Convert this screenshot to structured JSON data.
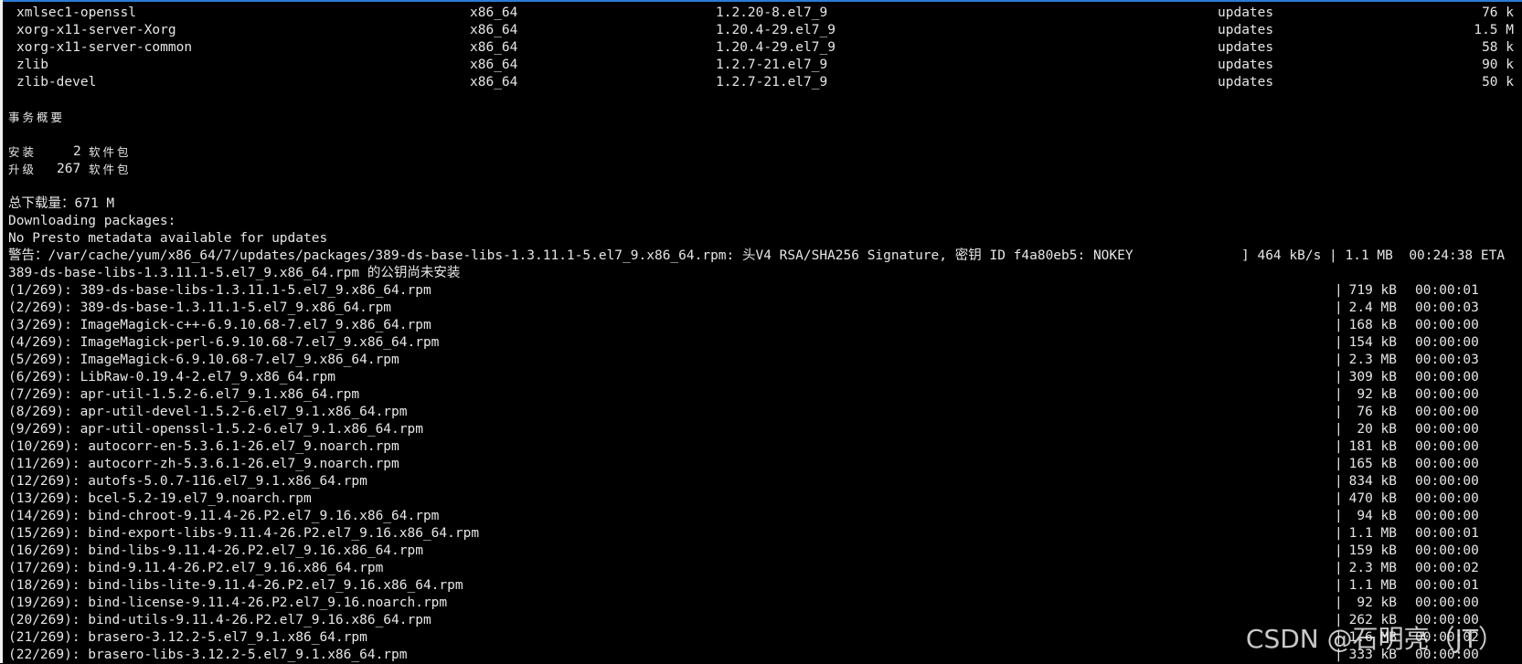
{
  "packages": [
    {
      "name": "xmlsec1-openssl",
      "arch": "x86_64",
      "version": "1.2.20-8.el7_9",
      "repo": "updates",
      "size": "76 k"
    },
    {
      "name": "xorg-x11-server-Xorg",
      "arch": "x86_64",
      "version": "1.20.4-29.el7_9",
      "repo": "updates",
      "size": "1.5 M"
    },
    {
      "name": "xorg-x11-server-common",
      "arch": "x86_64",
      "version": "1.20.4-29.el7_9",
      "repo": "updates",
      "size": "58 k"
    },
    {
      "name": "zlib",
      "arch": "x86_64",
      "version": "1.2.7-21.el7_9",
      "repo": "updates",
      "size": "90 k"
    },
    {
      "name": "zlib-devel",
      "arch": "x86_64",
      "version": "1.2.7-21.el7_9",
      "repo": "updates",
      "size": "50 k"
    }
  ],
  "summary": {
    "title": "事务概要",
    "install_label": "安装",
    "install_count": "2",
    "install_unit": "软件包",
    "upgrade_label": "升级",
    "upgrade_count": "267",
    "upgrade_unit": "软件包",
    "total_download": "总下载量：671 M"
  },
  "messages": {
    "downloading": "Downloading packages:",
    "no_presto": "No Presto metadata available for updates",
    "warning": "警告：/var/cache/yum/x86_64/7/updates/packages/389-ds-base-libs-1.3.11.1-5.el7_9.x86_64.rpm: 头V4 RSA/SHA256 Signature, 密钥 ID f4a80eb5: NOKEY",
    "warning_stats": "] 464 kB/s | 1.1 MB  00:24:38 ETA",
    "pubkey": "389-ds-base-libs-1.3.11.1-5.el7_9.x86_64.rpm 的公钥尚未安装"
  },
  "downloads": [
    {
      "file": "(1/269): 389-ds-base-libs-1.3.11.1-5.el7_9.x86_64.rpm",
      "size": "719 kB",
      "time": "00:00:01"
    },
    {
      "file": "(2/269): 389-ds-base-1.3.11.1-5.el7_9.x86_64.rpm",
      "size": "2.4 MB",
      "time": "00:00:03"
    },
    {
      "file": "(3/269): ImageMagick-c++-6.9.10.68-7.el7_9.x86_64.rpm",
      "size": "168 kB",
      "time": "00:00:00"
    },
    {
      "file": "(4/269): ImageMagick-perl-6.9.10.68-7.el7_9.x86_64.rpm",
      "size": "154 kB",
      "time": "00:00:00"
    },
    {
      "file": "(5/269): ImageMagick-6.9.10.68-7.el7_9.x86_64.rpm",
      "size": "2.3 MB",
      "time": "00:00:03"
    },
    {
      "file": "(6/269): LibRaw-0.19.4-2.el7_9.x86_64.rpm",
      "size": "309 kB",
      "time": "00:00:00"
    },
    {
      "file": "(7/269): apr-util-1.5.2-6.el7_9.1.x86_64.rpm",
      "size": "92 kB",
      "time": "00:00:00"
    },
    {
      "file": "(8/269): apr-util-devel-1.5.2-6.el7_9.1.x86_64.rpm",
      "size": "76 kB",
      "time": "00:00:00"
    },
    {
      "file": "(9/269): apr-util-openssl-1.5.2-6.el7_9.1.x86_64.rpm",
      "size": "20 kB",
      "time": "00:00:00"
    },
    {
      "file": "(10/269): autocorr-en-5.3.6.1-26.el7_9.noarch.rpm",
      "size": "181 kB",
      "time": "00:00:00"
    },
    {
      "file": "(11/269): autocorr-zh-5.3.6.1-26.el7_9.noarch.rpm",
      "size": "165 kB",
      "time": "00:00:00"
    },
    {
      "file": "(12/269): autofs-5.0.7-116.el7_9.1.x86_64.rpm",
      "size": "834 kB",
      "time": "00:00:00"
    },
    {
      "file": "(13/269): bcel-5.2-19.el7_9.noarch.rpm",
      "size": "470 kB",
      "time": "00:00:00"
    },
    {
      "file": "(14/269): bind-chroot-9.11.4-26.P2.el7_9.16.x86_64.rpm",
      "size": "94 kB",
      "time": "00:00:00"
    },
    {
      "file": "(15/269): bind-export-libs-9.11.4-26.P2.el7_9.16.x86_64.rpm",
      "size": "1.1 MB",
      "time": "00:00:01"
    },
    {
      "file": "(16/269): bind-libs-9.11.4-26.P2.el7_9.16.x86_64.rpm",
      "size": "159 kB",
      "time": "00:00:00"
    },
    {
      "file": "(17/269): bind-9.11.4-26.P2.el7_9.16.x86_64.rpm",
      "size": "2.3 MB",
      "time": "00:00:02"
    },
    {
      "file": "(18/269): bind-libs-lite-9.11.4-26.P2.el7_9.16.x86_64.rpm",
      "size": "1.1 MB",
      "time": "00:00:01"
    },
    {
      "file": "(19/269): bind-license-9.11.4-26.P2.el7_9.16.noarch.rpm",
      "size": "92 kB",
      "time": "00:00:00"
    },
    {
      "file": "(20/269): bind-utils-9.11.4-26.P2.el7_9.16.x86_64.rpm",
      "size": "262 kB",
      "time": "00:00:00"
    },
    {
      "file": "(21/269): brasero-3.12.2-5.el7_9.1.x86_64.rpm",
      "size": "1.6 MB",
      "time": "00:00:02"
    },
    {
      "file": "(22/269): brasero-libs-3.12.2-5.el7_9.1.x86_64.rpm",
      "size": "333 kB",
      "time": "00:00:00"
    }
  ],
  "watermark": "CSDN @石明亮（JT）"
}
